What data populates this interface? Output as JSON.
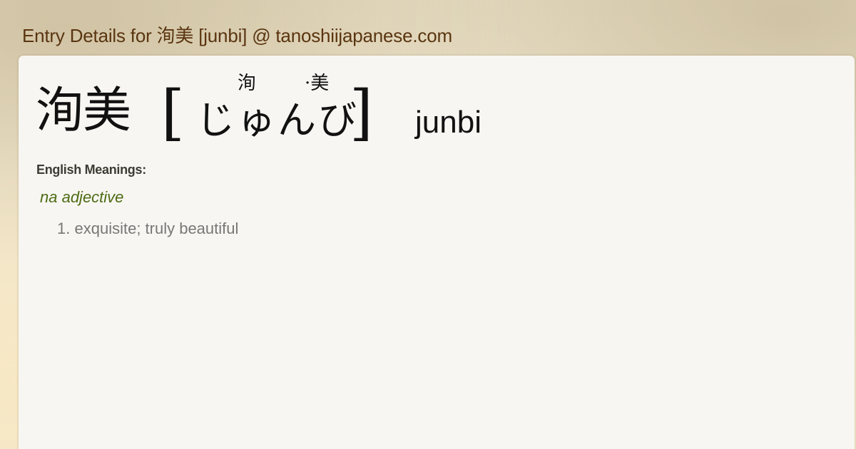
{
  "page": {
    "title": "Entry Details for 洵美 [junbi] @ tanoshiijapanese.com"
  },
  "entry": {
    "kanji": "洵美",
    "bracket_open": "[",
    "bracket_close": "]",
    "kana": "じゅんび",
    "furigana": [
      "洵",
      "·美"
    ],
    "romaji": "junbi"
  },
  "meanings": {
    "label": "English Meanings:",
    "part_of_speech": "na adjective",
    "items": [
      {
        "number": "1.",
        "text": "exquisite; truly beautiful"
      }
    ]
  },
  "colors": {
    "title": "#5a3510",
    "part_of_speech": "#4e6b14",
    "meaning_text": "#777777",
    "panel_bg": "#f7f6f2"
  }
}
